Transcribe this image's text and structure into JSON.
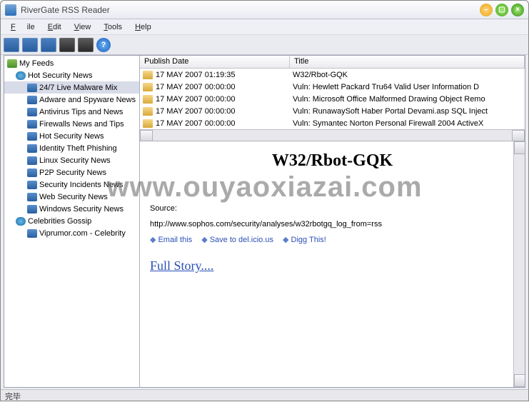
{
  "window": {
    "title": "RiverGate RSS Reader"
  },
  "menu": {
    "file": "File",
    "edit": "Edit",
    "view": "View",
    "tools": "Tools",
    "help": "Help"
  },
  "sidebar": {
    "root": "My Feeds",
    "groups": [
      {
        "label": "Hot Security News",
        "items": [
          {
            "label": "24/7 Live Malware Mix",
            "selected": true
          },
          {
            "label": "Adware and Spyware News"
          },
          {
            "label": "Antivirus Tips and News"
          },
          {
            "label": "Firewalls News and Tips"
          },
          {
            "label": "Hot Security News"
          },
          {
            "label": "Identity Theft Phishing"
          },
          {
            "label": "Linux Security News"
          },
          {
            "label": "P2P Security News"
          },
          {
            "label": "Security Incidents News"
          },
          {
            "label": "Web Security News"
          },
          {
            "label": "Windows Security News"
          }
        ]
      },
      {
        "label": "Celebrities Gossip",
        "items": [
          {
            "label": "Viprumor.com - Celebrity"
          }
        ]
      }
    ]
  },
  "list": {
    "columns": {
      "date": "Publish Date",
      "title": "Title"
    },
    "rows": [
      {
        "date": "17 MAY 2007 01:19:35",
        "title": "W32/Rbot-GQK"
      },
      {
        "date": "17 MAY 2007 00:00:00",
        "title": "Vuln: Hewlett Packard Tru64 Valid User Information D"
      },
      {
        "date": "17 MAY 2007 00:00:00",
        "title": "Vuln: Microsoft Office Malformed Drawing Object Remo"
      },
      {
        "date": "17 MAY 2007 00:00:00",
        "title": "Vuln: RunawaySoft Haber Portal Devami.asp SQL Inject"
      },
      {
        "date": "17 MAY 2007 00:00:00",
        "title": "Vuln: Symantec Norton Personal Firewall 2004 ActiveX"
      }
    ]
  },
  "article": {
    "heading": "W32/Rbot-GQK",
    "source_label": "Source:",
    "source_url": "http://www.sophos.com/security/analyses/w32rbotgq_log_from=rss",
    "actions": {
      "email": "Email this",
      "delicious": "Save to del.icio.us",
      "digg": "Digg This!"
    },
    "fullstory": "Full Story...."
  },
  "status": "完毕",
  "watermark": "www.ouyaoxiazai.com"
}
